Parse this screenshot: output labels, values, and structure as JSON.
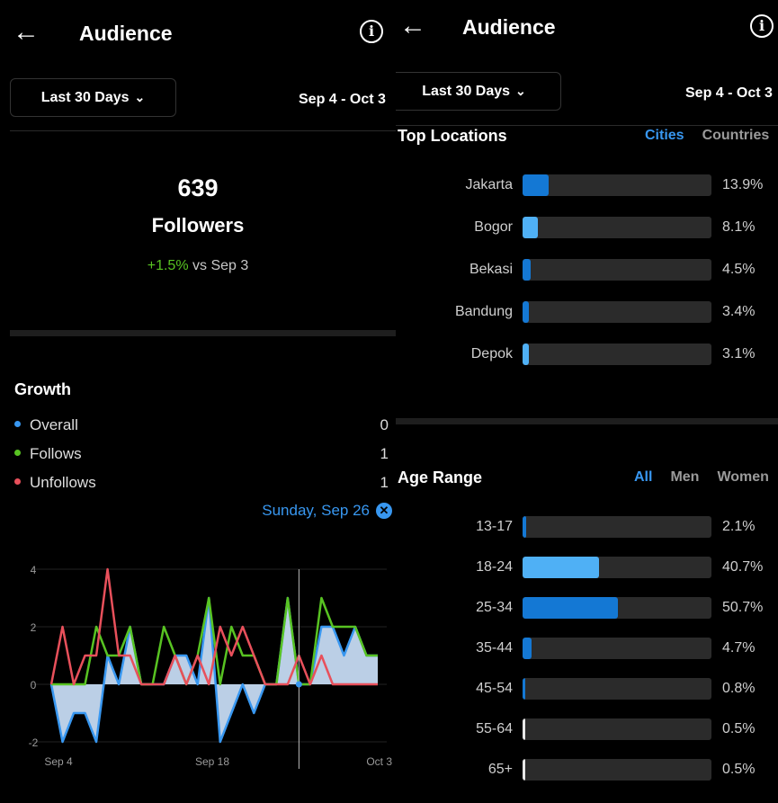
{
  "colors": {
    "accent": "#3897f0",
    "positive": "#58c322",
    "overall": "#3897f0",
    "follows": "#58c322",
    "unfollows": "#e8505b"
  },
  "left": {
    "header": {
      "back_icon": "arrow-left-icon",
      "title": "Audience",
      "info_icon": "info-icon"
    },
    "range": {
      "label": "Last 30 Days",
      "chevron": "chevron-down-icon",
      "dates": "Sep 4 - Oct 3"
    },
    "followers": {
      "count": "639",
      "label": "Followers",
      "change": "+1.5%",
      "vs": " vs Sep 3"
    },
    "growth": {
      "title": "Growth",
      "legend": [
        {
          "label": "Overall",
          "value": "0"
        },
        {
          "label": "Follows",
          "value": "1"
        },
        {
          "label": "Unfollows",
          "value": "1"
        }
      ],
      "selected_date": "Sunday, Sep 26",
      "close_icon": "close-circle-icon"
    },
    "chart_data": {
      "type": "line",
      "x": [
        "Sep 4",
        "Sep 5",
        "Sep 6",
        "Sep 7",
        "Sep 8",
        "Sep 9",
        "Sep 10",
        "Sep 11",
        "Sep 12",
        "Sep 13",
        "Sep 14",
        "Sep 15",
        "Sep 16",
        "Sep 17",
        "Sep 18",
        "Sep 19",
        "Sep 20",
        "Sep 21",
        "Sep 22",
        "Sep 23",
        "Sep 24",
        "Sep 25",
        "Sep 26",
        "Sep 27",
        "Sep 28",
        "Sep 29",
        "Sep 30",
        "Oct 1",
        "Oct 2",
        "Oct 3"
      ],
      "x_tick_labels": [
        "Sep 4",
        "Sep 18",
        "Oct 3"
      ],
      "y_tick_labels": [
        "4",
        "2",
        "0",
        "-2"
      ],
      "ylim": [
        -2,
        4
      ],
      "series": [
        {
          "name": "Overall",
          "values": [
            0,
            -2,
            -1,
            -1,
            -2,
            1,
            0,
            2,
            0,
            0,
            0,
            1,
            1,
            0,
            3,
            -2,
            -1,
            0,
            -1,
            0,
            0,
            3,
            0,
            0,
            2,
            2,
            1,
            2,
            1,
            1
          ]
        },
        {
          "name": "Follows",
          "values": [
            0,
            0,
            0,
            0,
            2,
            1,
            1,
            2,
            0,
            0,
            2,
            1,
            0,
            1,
            3,
            0,
            2,
            1,
            1,
            0,
            0,
            3,
            0,
            0,
            3,
            2,
            2,
            2,
            1,
            1
          ]
        },
        {
          "name": "Unfollows",
          "values": [
            0,
            2,
            0,
            1,
            1,
            4,
            1,
            1,
            0,
            0,
            0,
            1,
            0,
            1,
            0,
            2,
            1,
            2,
            1,
            0,
            0,
            0,
            1,
            0,
            1,
            0,
            0,
            0,
            0,
            0
          ]
        }
      ],
      "selected_index": 22
    }
  },
  "right": {
    "header": {
      "back_icon": "arrow-left-icon",
      "title": "Audience",
      "info_icon": "info-icon"
    },
    "range": {
      "label": "Last 30 Days",
      "chevron": "chevron-down-icon",
      "dates": "Sep 4 - Oct 3"
    },
    "locations": {
      "title": "Top Locations",
      "tabs": [
        {
          "label": "Cities",
          "active": true
        },
        {
          "label": "Countries",
          "active": false
        }
      ],
      "items": [
        {
          "label": "Jakarta",
          "value": "13.9%",
          "pct": 13.9,
          "color": "#1478d4"
        },
        {
          "label": "Bogor",
          "value": "8.1%",
          "pct": 8.1,
          "color": "#4fb0f5"
        },
        {
          "label": "Bekasi",
          "value": "4.5%",
          "pct": 4.5,
          "color": "#1478d4"
        },
        {
          "label": "Bandung",
          "value": "3.4%",
          "pct": 3.4,
          "color": "#1478d4"
        },
        {
          "label": "Depok",
          "value": "3.1%",
          "pct": 3.1,
          "color": "#4fb0f5"
        }
      ]
    },
    "age": {
      "title": "Age Range",
      "tabs": [
        {
          "label": "All",
          "active": true
        },
        {
          "label": "Men",
          "active": false
        },
        {
          "label": "Women",
          "active": false
        }
      ],
      "items": [
        {
          "label": "13-17",
          "value": "2.1%",
          "pct": 2.1,
          "color": "#1478d4"
        },
        {
          "label": "18-24",
          "value": "40.7%",
          "pct": 40.7,
          "color": "#4fb0f5"
        },
        {
          "label": "25-34",
          "value": "50.7%",
          "pct": 50.7,
          "color": "#1478d4"
        },
        {
          "label": "35-44",
          "value": "4.7%",
          "pct": 4.7,
          "color": "#1478d4"
        },
        {
          "label": "45-54",
          "value": "0.8%",
          "pct": 0.8,
          "color": "#1478d4"
        },
        {
          "label": "55-64",
          "value": "0.5%",
          "pct": 0.5,
          "color": "#e8e8e8"
        },
        {
          "label": "65+",
          "value": "0.5%",
          "pct": 0.5,
          "color": "#e8e8e8"
        }
      ]
    }
  }
}
